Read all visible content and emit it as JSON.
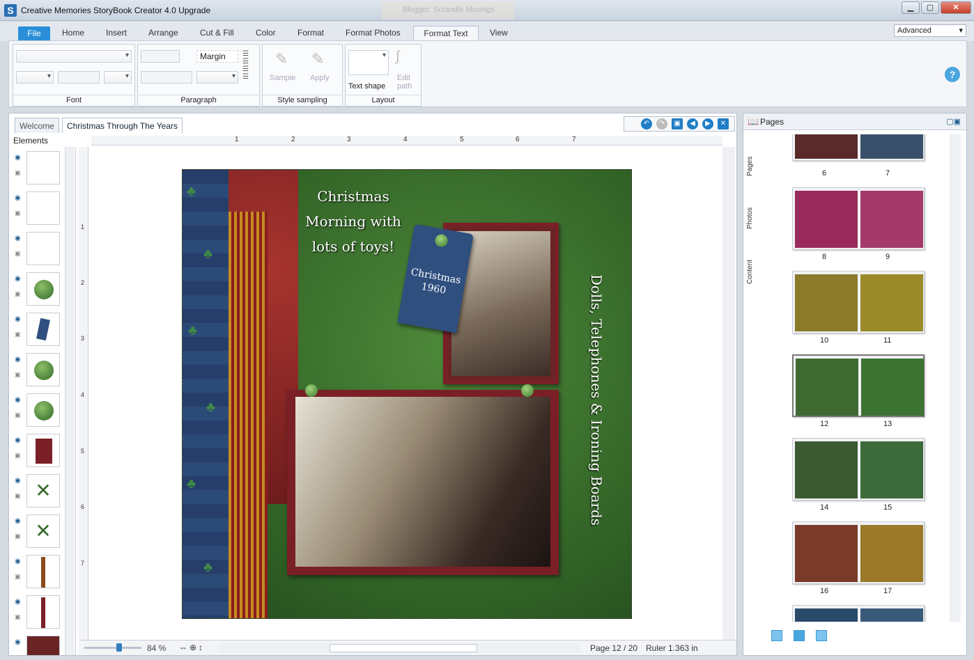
{
  "window": {
    "title": "Creative Memories StoryBook Creator 4.0 Upgrade",
    "app_icon": "S",
    "background_tab": "Blogger: Scrandle Musings",
    "controls": [
      "▁",
      "▢",
      "✕"
    ]
  },
  "ribbon": {
    "tabs": [
      "File",
      "Home",
      "Insert",
      "Arrange",
      "Cut & Fill",
      "Color",
      "Format",
      "Format Photos",
      "Format Text",
      "View"
    ],
    "mode": "Advanced",
    "groups": {
      "font": "Font",
      "paragraph": "Paragraph",
      "paragraph_margin": "Margin",
      "style_sampling": "Style sampling",
      "sample": "Sample",
      "apply": "Apply",
      "layout": "Layout",
      "text_shape": "Text shape",
      "edit_path": "Edit path"
    },
    "help": "?"
  },
  "document": {
    "tabs": [
      "Welcome",
      "Christmas Through The Years"
    ],
    "elements_label": "Elements",
    "ruler_h": [
      "1",
      "2",
      "3",
      "4",
      "5",
      "6",
      "7"
    ],
    "ruler_v": [
      "1",
      "2",
      "3",
      "4",
      "5",
      "6",
      "7"
    ],
    "page": {
      "headline": "Christmas Morning with lots of toys!",
      "tag": "Christmas 1960",
      "side_caption": "Dolls, Telephones & Ironing Boards"
    },
    "status": {
      "zoom": "84 %",
      "page": "Page 12 / 20",
      "ruler": "Ruler 1.363 in"
    }
  },
  "pages_panel": {
    "title": "Pages",
    "side_tabs": [
      "Pages",
      "Photos",
      "Content"
    ],
    "spreads": [
      {
        "left": "6",
        "right": "7"
      },
      {
        "left": "8",
        "right": "9"
      },
      {
        "left": "10",
        "right": "11"
      },
      {
        "left": "12",
        "right": "13"
      },
      {
        "left": "14",
        "right": "15"
      },
      {
        "left": "16",
        "right": "17"
      }
    ]
  }
}
